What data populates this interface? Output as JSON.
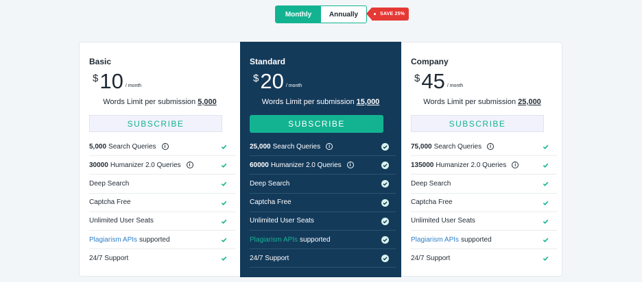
{
  "toggle": {
    "monthly": "Monthly",
    "annually": "Annually",
    "save": "SAVE 25%"
  },
  "colors": {
    "accent": "#13b392",
    "featured_bg": "#143a5a",
    "save_tag": "#e53935",
    "link": "#2f80c9"
  },
  "plans": [
    {
      "name": "Basic",
      "currency": "$",
      "price": "10",
      "per": "/ month",
      "limit_label": "Words Limit per submission",
      "limit_value": "5,000",
      "subscribe": "SUBSCRIBE",
      "features": [
        {
          "bold": "5,000",
          "text": "Search Queries"
        },
        {
          "bold": "30000",
          "text": "Humanizer 2.0 Queries"
        },
        {
          "text": "Deep Search"
        },
        {
          "text": "Captcha Free"
        },
        {
          "text": "Unlimited User Seats"
        },
        {
          "link": "Plagiarism APIs",
          "text": "supported"
        },
        {
          "text": "24/7 Support"
        }
      ]
    },
    {
      "name": "Standard",
      "currency": "$",
      "price": "20",
      "per": "/ month",
      "limit_label": "Words Limit per submission",
      "limit_value": "15,000",
      "subscribe": "SUBSCRIBE",
      "features": [
        {
          "bold": "25,000",
          "text": "Search Queries"
        },
        {
          "bold": "60000",
          "text": "Humanizer 2.0 Queries"
        },
        {
          "text": "Deep Search"
        },
        {
          "text": "Captcha Free"
        },
        {
          "text": "Unlimited User Seats"
        },
        {
          "link": "Plagiarism APIs",
          "text": "supported"
        },
        {
          "text": "24/7 Support"
        }
      ]
    },
    {
      "name": "Company",
      "currency": "$",
      "price": "45",
      "per": "/ month",
      "limit_label": "Words Limit per submission",
      "limit_value": "25,000",
      "subscribe": "SUBSCRIBE",
      "features": [
        {
          "bold": "75,000",
          "text": "Search Queries"
        },
        {
          "bold": "135000",
          "text": "Humanizer 2.0 Queries"
        },
        {
          "text": "Deep Search"
        },
        {
          "text": "Captcha Free"
        },
        {
          "text": "Unlimited User Seats"
        },
        {
          "link": "Plagiarism APIs",
          "text": "supported"
        },
        {
          "text": "24/7 Support"
        }
      ]
    }
  ]
}
